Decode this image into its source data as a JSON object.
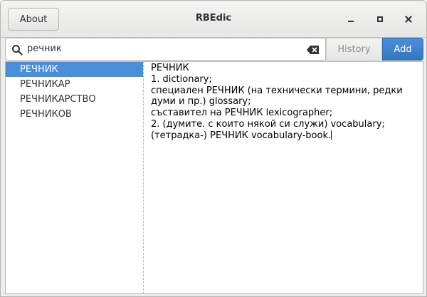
{
  "window": {
    "title": "RBEdic",
    "about_label": "About"
  },
  "toolbar": {
    "search_value": "речник",
    "history_label": "History",
    "add_label": "Add"
  },
  "word_list": {
    "items": [
      "РЕЧНИК",
      "РЕЧНИКАР",
      "РЕЧНИКАРСТВО",
      "РЕЧНИКОВ"
    ],
    "selected_index": 0
  },
  "definition": {
    "lines": [
      "РЕЧНИК",
      "1. dictionary;",
      "специален РЕЧНИК (на технически термини, редки",
      "думи и пр.) glossary;",
      "съставител на РЕЧНИК lexicographer;",
      "2. (думите. с които някой си служи) vocabulary;",
      "(тетрадка-) РЕЧНИК vocabulary-book."
    ]
  },
  "icons": {
    "search": "search-icon",
    "clear": "edit-clear-icon",
    "minimize": "minimize-icon",
    "maximize": "maximize-icon",
    "close": "close-icon"
  },
  "colors": {
    "accent": "#4a90d9",
    "selection_text": "#ffffff"
  }
}
